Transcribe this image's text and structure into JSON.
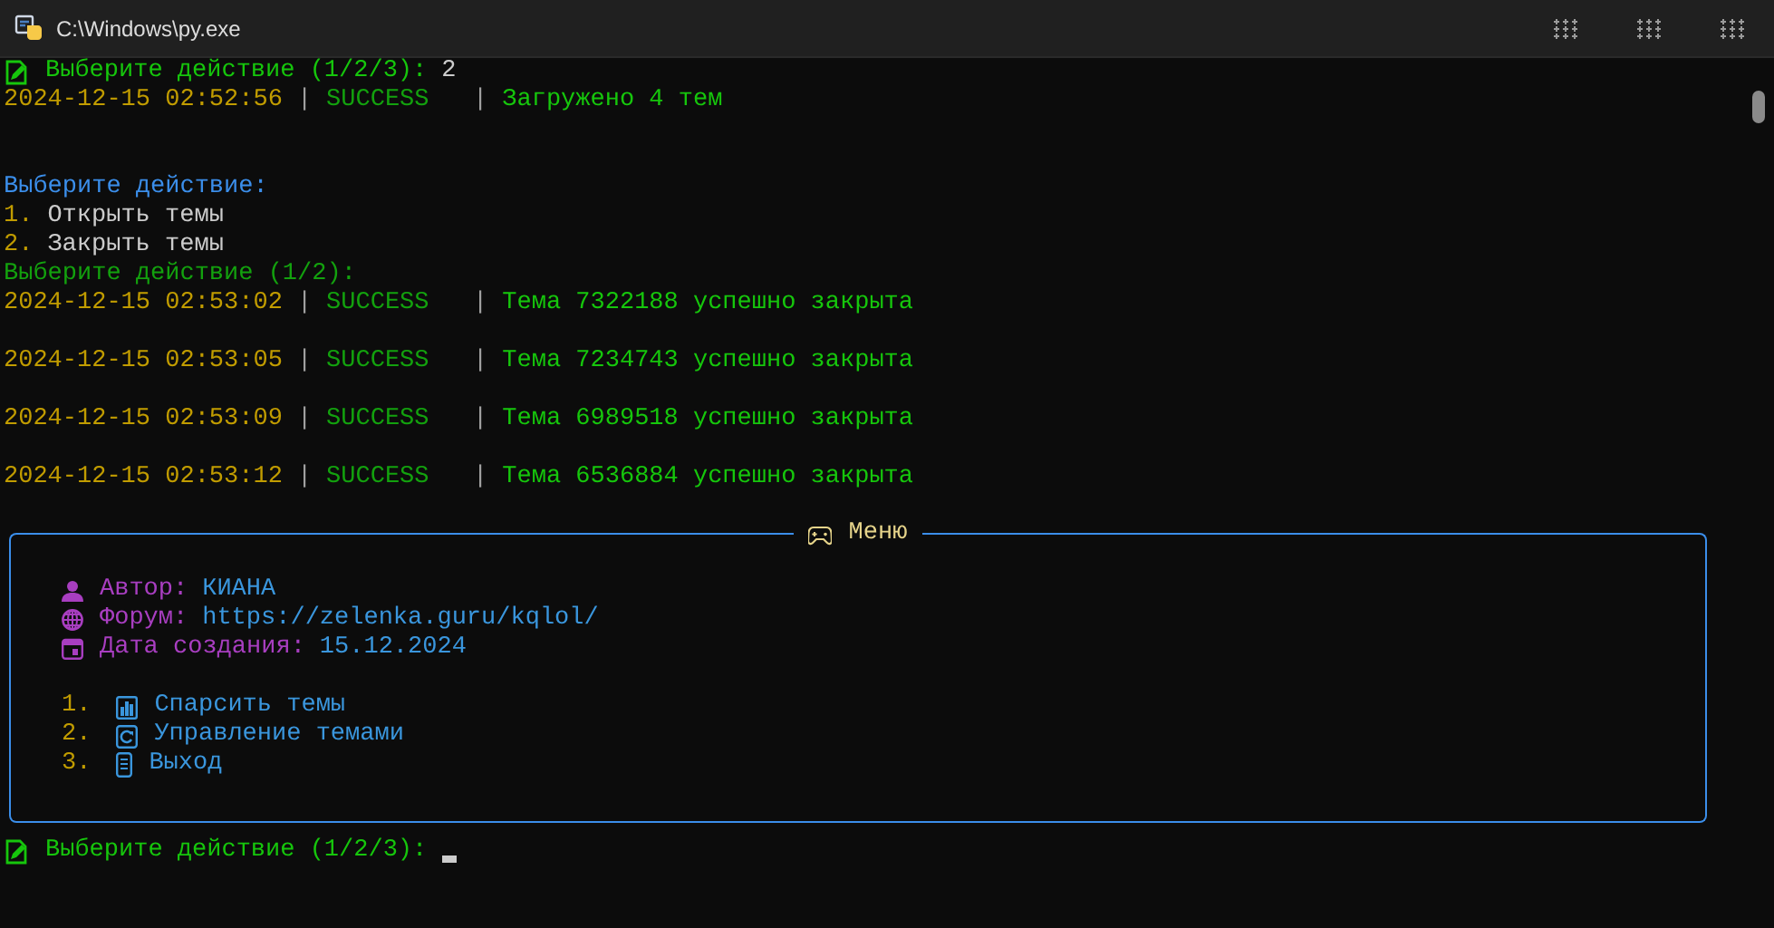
{
  "window": {
    "title": "C:\\Windows\\py.exe"
  },
  "lines": [
    {
      "kind": "prompt",
      "text": "Выберите действие (1/2/3):",
      "value": "2"
    },
    {
      "kind": "log",
      "timestamp": "2024-12-15 02:52:56",
      "separator_1": "|",
      "level": "SUCCESS",
      "separator_2": "|",
      "message": "Загружено 4 тем"
    },
    {
      "kind": "blank"
    },
    {
      "kind": "blank"
    },
    {
      "kind": "heading",
      "text": "Выберите действие:"
    },
    {
      "kind": "option",
      "number": "1.",
      "text": "Открыть темы"
    },
    {
      "kind": "option",
      "number": "2.",
      "text": "Закрыть темы"
    },
    {
      "kind": "question",
      "text": "Выберите действие (1/2):"
    },
    {
      "kind": "log",
      "timestamp": "2024-12-15 02:53:02",
      "separator_1": "|",
      "level": "SUCCESS",
      "separator_2": "|",
      "message": "Тема 7322188 успешно закрыта"
    },
    {
      "kind": "blank"
    },
    {
      "kind": "log",
      "timestamp": "2024-12-15 02:53:05",
      "separator_1": "|",
      "level": "SUCCESS",
      "separator_2": "|",
      "message": "Тема 7234743 успешно закрыта"
    },
    {
      "kind": "blank"
    },
    {
      "kind": "log",
      "timestamp": "2024-12-15 02:53:09",
      "separator_1": "|",
      "level": "SUCCESS",
      "separator_2": "|",
      "message": "Тема 6989518 успешно закрыта"
    },
    {
      "kind": "blank"
    },
    {
      "kind": "log",
      "timestamp": "2024-12-15 02:53:12",
      "separator_1": "|",
      "level": "SUCCESS",
      "separator_2": "|",
      "message": "Тема 6536884 успешно закрыта"
    }
  ],
  "panel": {
    "title": "Меню",
    "info": [
      {
        "kind": "user",
        "label": "Автор:",
        "value": "КИАНА"
      },
      {
        "kind": "globe",
        "label": "Форум:",
        "value": "https://zelenka.guru/kqlol/"
      },
      {
        "kind": "calendar",
        "label": "Дата создания:",
        "value": "15.12.2024"
      }
    ],
    "items": [
      {
        "kind": "chart",
        "number": "1.",
        "label": "Спарсить темы"
      },
      {
        "kind": "refresh",
        "number": "2.",
        "label": "Управление темами"
      },
      {
        "kind": "phone",
        "number": "3.",
        "label": "Выход"
      }
    ]
  },
  "input": {
    "text": "Выберите действие (1/2/3):",
    "cursor": true
  }
}
